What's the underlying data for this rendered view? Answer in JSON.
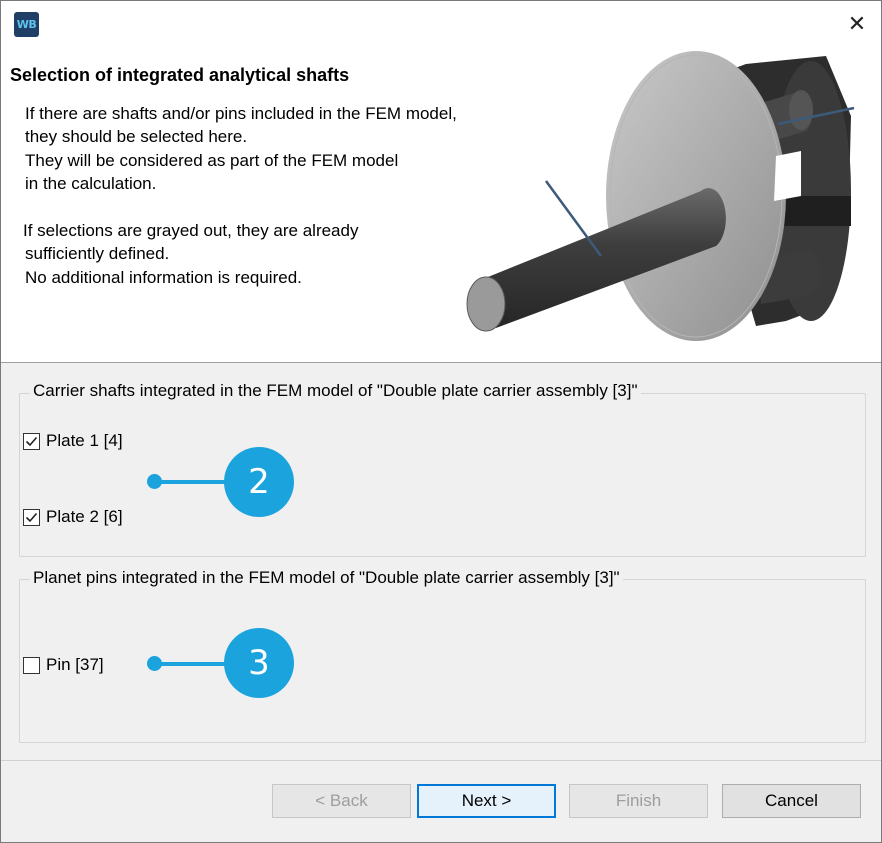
{
  "window": {
    "app_icon_text": "WB",
    "close_symbol": "✕"
  },
  "header": {
    "title": "Selection of integrated analytical shafts",
    "description_lines": [
      "If there are shafts and/or pins included in the FEM model,",
      "they should be selected here.",
      "They will be considered as part of the FEM model",
      "in the calculation.",
      "If selections are grayed out, they are already",
      "sufficiently defined.",
      "No additional information is required."
    ]
  },
  "carrier_group": {
    "legend": "Carrier shafts integrated in the FEM model of \"Double plate carrier assembly [3]\"",
    "items": [
      {
        "label": "Plate 1 [4]",
        "checked": true
      },
      {
        "label": "Plate 2 [6]",
        "checked": true
      }
    ],
    "callout": "2"
  },
  "pins_group": {
    "legend": "Planet pins integrated in the FEM model of \"Double plate carrier assembly [3]\"",
    "items": [
      {
        "label": "Pin [37]",
        "checked": false
      }
    ],
    "callout": "3"
  },
  "buttons": {
    "back": "< Back",
    "next": "Next >",
    "finish": "Finish",
    "cancel": "Cancel"
  },
  "colors": {
    "callout": "#1aa3dc",
    "accent_border": "#0078d7"
  }
}
